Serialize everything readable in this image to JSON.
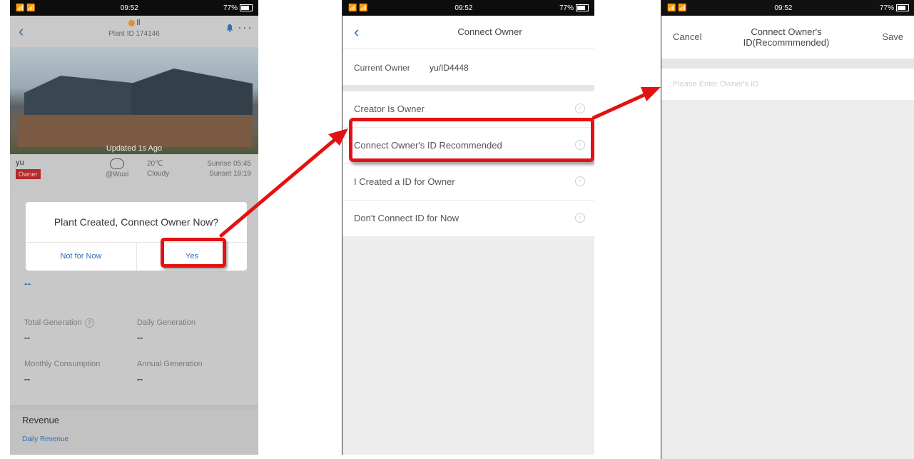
{
  "phone1": {
    "status": {
      "left": "📶 📶",
      "time": "09:52",
      "right": "77%"
    },
    "header": {
      "title": "ll",
      "subtitle": "Plant ID 174146"
    },
    "photo": {
      "updated": "Updated 1s Ago"
    },
    "info": {
      "owner_name": "yu",
      "owner_badge": "Owner",
      "location": "@Wuxi",
      "temperature": "20℃",
      "condition": "Cloudy",
      "sunrise": "Sunrise 05:45",
      "sunset": "Sunset 18:19"
    },
    "current_value": "--",
    "stats": {
      "total_generation": {
        "label": "Total Generation",
        "value": "--"
      },
      "daily_generation": {
        "label": "Daily Generation",
        "value": "--"
      },
      "monthly_consumption": {
        "label": "Monthly Consumption",
        "value": "--"
      },
      "annual_generation": {
        "label": "Annual Generation",
        "value": "--"
      }
    },
    "revenue": {
      "title": "Revenue",
      "link": "Daily Revenue"
    },
    "dialog": {
      "message": "Plant Created, Connect Owner Now?",
      "cancel": "Not for Now",
      "confirm": "Yes"
    }
  },
  "phone2": {
    "status": {
      "left": "📶 📶",
      "time": "09:52",
      "right": "77%"
    },
    "nav": {
      "title": "Connect Owner"
    },
    "current_owner": {
      "label": "Current Owner",
      "value": "yu/ID4448"
    },
    "options": [
      {
        "label": "Creator Is Owner"
      },
      {
        "label": "Connect Owner's ID Recommended"
      },
      {
        "label": "I Created a ID for Owner"
      },
      {
        "label": "Don't Connect ID for Now"
      }
    ]
  },
  "phone3": {
    "status": {
      "left": "📶 📶",
      "time": "09:52",
      "right": "77%"
    },
    "nav": {
      "cancel": "Cancel",
      "title_line1": "Connect Owner's",
      "title_line2": "ID(Recommmended)",
      "save": "Save"
    },
    "input": {
      "placeholder": "Please Enter Owner's ID",
      "value": ""
    }
  },
  "colors": {
    "accent": "#2f6fb8",
    "highlight": "#e31212",
    "badge": "#b22a2a"
  }
}
